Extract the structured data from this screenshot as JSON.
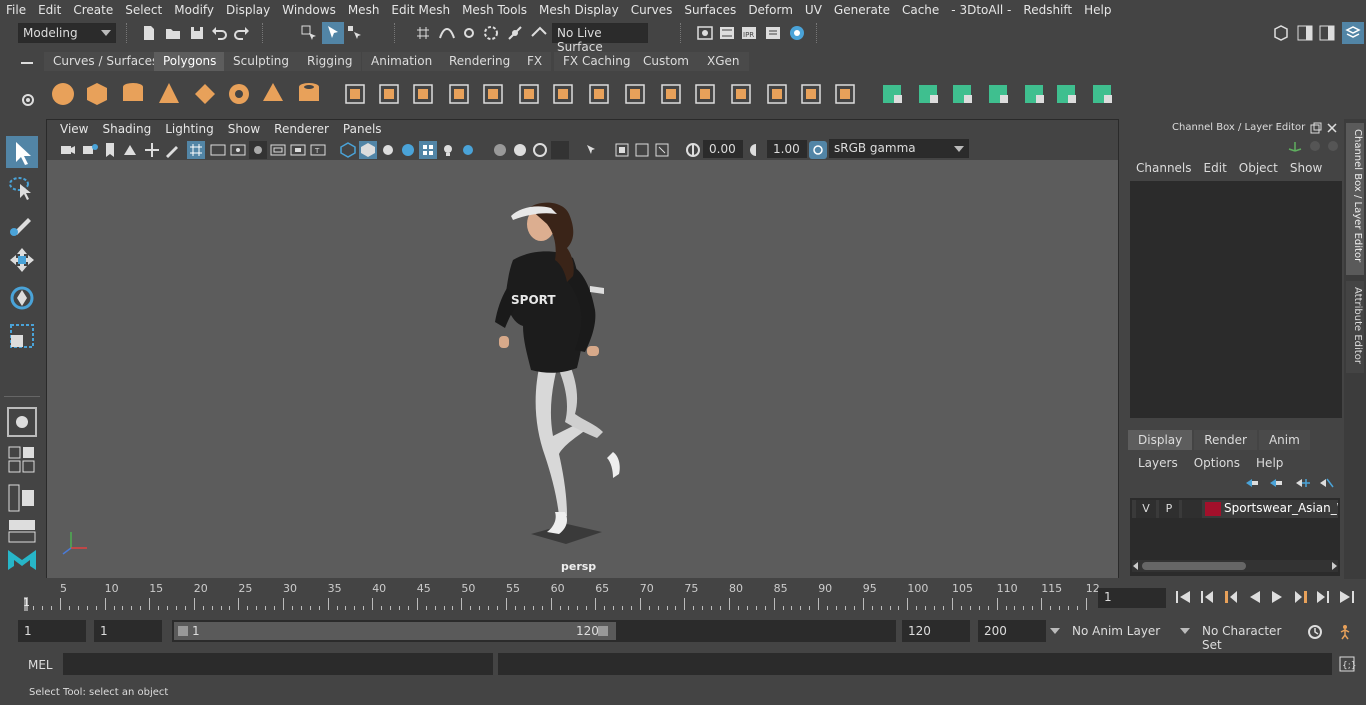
{
  "menubar": {
    "items": [
      "File",
      "Edit",
      "Create",
      "Select",
      "Modify",
      "Display",
      "Windows",
      "Mesh",
      "Edit Mesh",
      "Mesh Tools",
      "Mesh Display",
      "Curves",
      "Surfaces",
      "Deform",
      "UV",
      "Generate",
      "Cache",
      "- 3DtoAll -",
      "Redshift",
      "Help"
    ]
  },
  "statusline": {
    "mode": "Modeling",
    "live_surface": "No Live Surface"
  },
  "shelf": {
    "tabs": [
      "Curves / Surfaces",
      "Polygons",
      "Sculpting",
      "Rigging",
      "Animation",
      "Rendering",
      "FX",
      "FX Caching",
      "Custom",
      "XGen"
    ],
    "active_tab": "Polygons"
  },
  "viewport": {
    "menu": [
      "View",
      "Shading",
      "Lighting",
      "Show",
      "Renderer",
      "Panels"
    ],
    "exposure": "0.00",
    "gamma": "1.00",
    "color_space": "sRGB gamma",
    "camera_label": "persp",
    "shirt_text": "SPORT"
  },
  "channelbox": {
    "title": "Channel Box / Layer Editor",
    "menu": [
      "Channels",
      "Edit",
      "Object",
      "Show"
    ],
    "layer_tabs": [
      "Display",
      "Render",
      "Anim"
    ],
    "active_layer_tab": "Display",
    "layer_menu": [
      "Layers",
      "Options",
      "Help"
    ],
    "layer": {
      "v": "V",
      "p": "P",
      "name": "Sportswear_Asian_Wo",
      "color": "#a3102b"
    }
  },
  "sidetabs": {
    "channel": "Channel Box / Layer Editor",
    "attribute": "Attribute Editor"
  },
  "timeline": {
    "ticks": [
      "5",
      "10",
      "15",
      "20",
      "25",
      "30",
      "35",
      "40",
      "45",
      "50",
      "55",
      "60",
      "65",
      "70",
      "75",
      "80",
      "85",
      "90",
      "95",
      "100",
      "105",
      "110",
      "115",
      "12"
    ],
    "start_marker": "1",
    "current_frame": "1"
  },
  "range": {
    "start": "1",
    "anim_start": "1",
    "slider_start": "1",
    "slider_end": "120",
    "end": "120",
    "anim_end": "200",
    "anim_layer": "No Anim Layer",
    "character_set": "No Character Set"
  },
  "mel": {
    "label": "MEL"
  },
  "help": {
    "text": "Select Tool: select an object"
  },
  "colors": {
    "shelf_icon": "#e8a15a",
    "shelf_icon_green": "#3fbf8f",
    "active_tool": "#5285a6"
  }
}
